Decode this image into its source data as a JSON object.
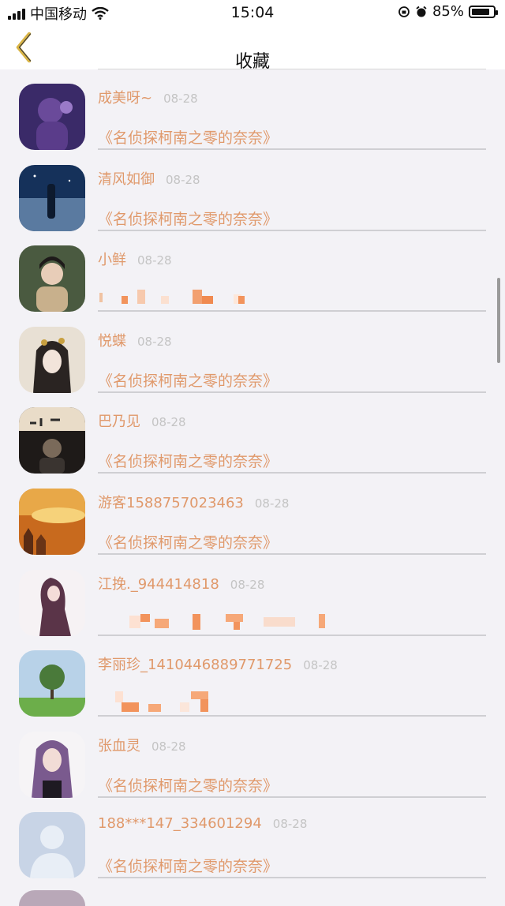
{
  "status_bar": {
    "carrier": "中国移动",
    "time": "15:04",
    "battery": "85%",
    "battery_level": 0.85
  },
  "nav": {
    "title": "收藏"
  },
  "favorites": [
    {
      "name": "成美呀~",
      "date": "08-28",
      "title": "《名侦探柯南之零的奈奈》",
      "avatar_icon": "anime-girl-purple-avatar"
    },
    {
      "name": "清风如御",
      "date": "08-28",
      "title": "《名侦探柯南之零的奈奈》",
      "avatar_icon": "night-sky-girl-avatar"
    },
    {
      "name": "小鲜",
      "date": "08-28",
      "title": "",
      "avatar_icon": "costume-girl-avatar"
    },
    {
      "name": "悦蝶",
      "date": "08-28",
      "title": "《名侦探柯南之零的奈奈》",
      "avatar_icon": "ancient-style-girl-avatar"
    },
    {
      "name": "巴乃见",
      "date": "08-28",
      "title": "《名侦探柯南之零的奈奈》",
      "avatar_icon": "movie-scene-avatar"
    },
    {
      "name": "游客1588757023463",
      "date": "08-28",
      "title": "《名侦探柯南之零的奈奈》",
      "avatar_icon": "sunset-castle-avatar"
    },
    {
      "name": "江挽._944414818",
      "date": "08-28",
      "title": "",
      "avatar_icon": "anime-long-hair-avatar"
    },
    {
      "name": "李丽珍_1410446889771725",
      "date": "08-28",
      "title": "",
      "avatar_icon": "tree-landscape-avatar"
    },
    {
      "name": "张血灵",
      "date": "08-28",
      "title": "《名侦探柯南之零的奈奈》",
      "avatar_icon": "purple-hair-girl-avatar"
    },
    {
      "name": "188***147_334601294",
      "date": "08-28",
      "title": "《名侦探柯南之零的奈奈》",
      "avatar_icon": "default-user-avatar"
    }
  ],
  "colors": {
    "accent": "#e0996b",
    "date": "#c4c4c4",
    "background": "#f3f2f6"
  }
}
